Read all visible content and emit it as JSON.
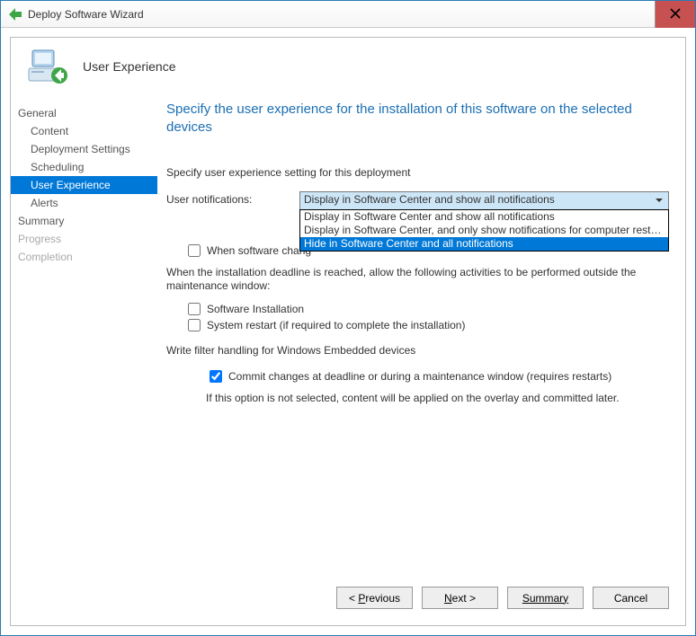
{
  "window": {
    "title": "Deploy Software Wizard"
  },
  "header": {
    "page_title": "User Experience"
  },
  "nav": {
    "items": [
      {
        "label": "General",
        "sub": false,
        "selected": false,
        "disabled": false
      },
      {
        "label": "Content",
        "sub": true,
        "selected": false,
        "disabled": false
      },
      {
        "label": "Deployment Settings",
        "sub": true,
        "selected": false,
        "disabled": false
      },
      {
        "label": "Scheduling",
        "sub": true,
        "selected": false,
        "disabled": false
      },
      {
        "label": "User Experience",
        "sub": true,
        "selected": true,
        "disabled": false
      },
      {
        "label": "Alerts",
        "sub": true,
        "selected": false,
        "disabled": false
      },
      {
        "label": "Summary",
        "sub": false,
        "selected": false,
        "disabled": false
      },
      {
        "label": "Progress",
        "sub": false,
        "selected": false,
        "disabled": true
      },
      {
        "label": "Completion",
        "sub": false,
        "selected": false,
        "disabled": true
      }
    ]
  },
  "content": {
    "heading": "Specify the user experience for the installation of this software on the selected devices",
    "setting_intro": "Specify user experience setting for this deployment",
    "notifications_label": "User notifications:",
    "notifications_value": "Display in Software Center and show all notifications",
    "notifications_options": [
      "Display in Software Center and show all notifications",
      "Display in Software Center, and only show notifications for computer restarts",
      "Hide in Software Center and all notifications"
    ],
    "checkbox_partial": "When software chang",
    "deadline_text": "When the installation deadline is reached, allow the following activities to be performed outside the maintenance window:",
    "software_install_label": "Software Installation",
    "system_restart_label": "System restart  (if required to complete the installation)",
    "writefilter_label": "Write filter handling for Windows Embedded devices",
    "commit_label": "Commit changes at deadline or during a maintenance window (requires restarts)",
    "commit_note": "If this option is not selected, content will be applied on the overlay and committed later."
  },
  "buttons": {
    "previous": "Previous",
    "next": "Next",
    "summary": "Summary",
    "cancel": "Cancel"
  }
}
